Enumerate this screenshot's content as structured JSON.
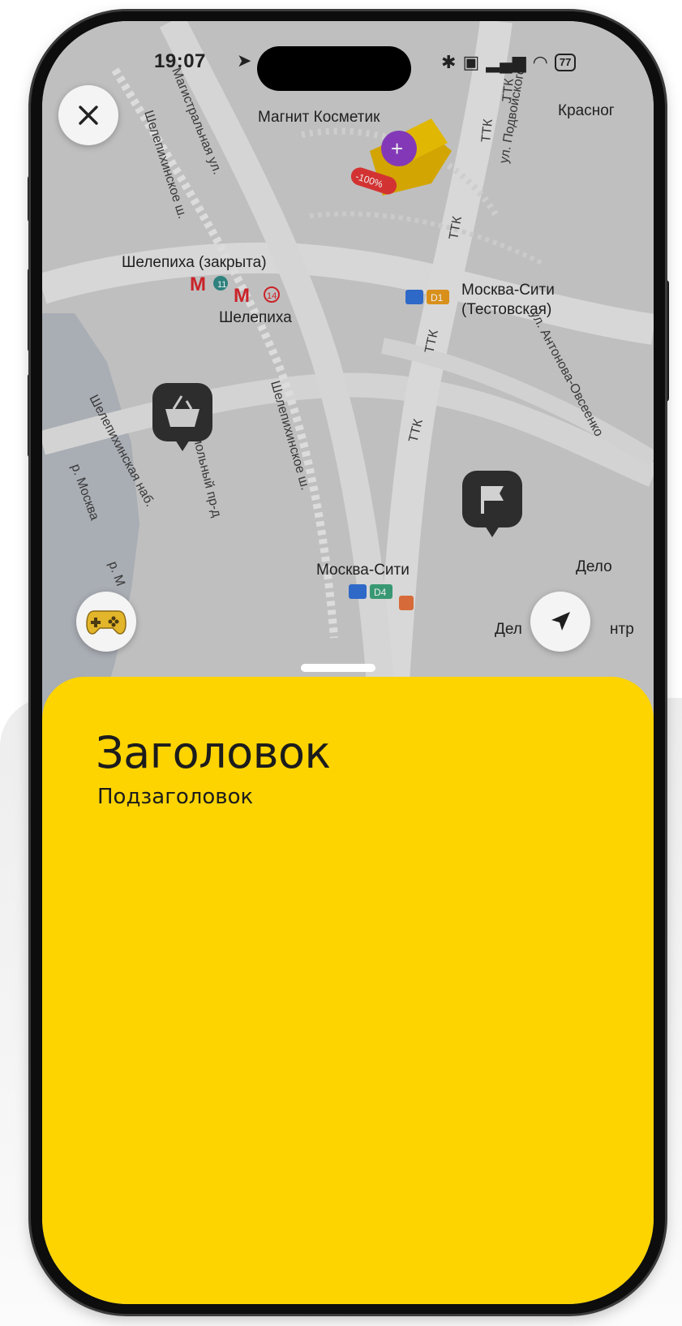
{
  "status_bar": {
    "time": "19:07",
    "battery": "77"
  },
  "map": {
    "labels": {
      "magnit": "Магнит Косметик",
      "krasno": "Красног",
      "shelepikha_closed": "Шелепиха (закрыта)",
      "shelepikha": "Шелепиха",
      "line11": "11",
      "line14": "14",
      "moscow_city_test_1": "Москва-Сити",
      "moscow_city_test_2": "(Тестовская)",
      "d1": "D1",
      "moscow_city": "Москва-Сити",
      "d4": "D4",
      "delo_1": "Дело",
      "delo_2": "Дел",
      "delo_3": "нтр",
      "discount": "-100%"
    },
    "streets": {
      "magistralnaya": "Магистральная ул.",
      "shelepikhinskoe_1": "Шелепихинское ш.",
      "shelepikhinskoe_2": "Шелепихинское ш.",
      "shelepikhinskaya_nab": "Шелепихинская наб.",
      "podvoyskogo": "ул. Подвойского",
      "antonova": "ул. Антонова-Овсеенко",
      "ttk_1": "ТТК",
      "ttk_2": "ТТК",
      "ttk_3": "ТТК",
      "ttk_4": "ТТК",
      "ttk_5": "ТТК",
      "mol": "мольный пр-д",
      "river_1": "р. Москва",
      "river_2": "р. М"
    }
  },
  "sheet": {
    "title": "Заголовок",
    "subtitle": "Подзаголовок"
  },
  "colors": {
    "accent": "#fdd400",
    "metro_red": "#d8232a",
    "pin_dark": "#2e2e2e"
  },
  "icons": {
    "close": "close-icon",
    "game": "gamepad-icon",
    "location": "navigation-arrow-icon",
    "basket": "basket-icon",
    "flag": "flag-icon"
  }
}
